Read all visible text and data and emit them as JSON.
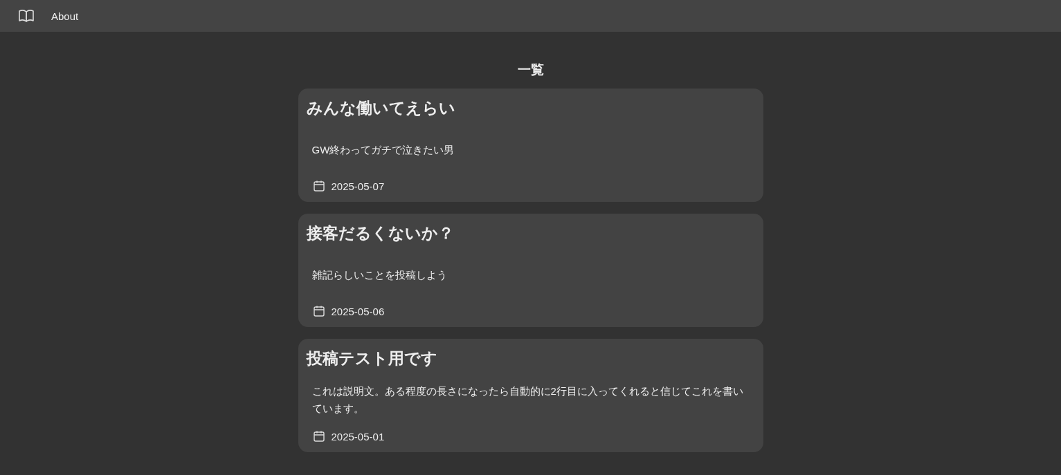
{
  "nav": {
    "about": "About"
  },
  "heading": "一覧",
  "posts": [
    {
      "title": "みんな働いてえらい",
      "description": "GW終わってガチで泣きたい男",
      "date": "2025-05-07"
    },
    {
      "title": "接客だるくないか？",
      "description": "雑記らしいことを投稿しよう",
      "date": "2025-05-06"
    },
    {
      "title": "投稿テスト用です",
      "description": "これは説明文。ある程度の長さになったら自動的に2行目に入ってくれると信じてこれを書いています。",
      "date": "2025-05-01"
    }
  ]
}
